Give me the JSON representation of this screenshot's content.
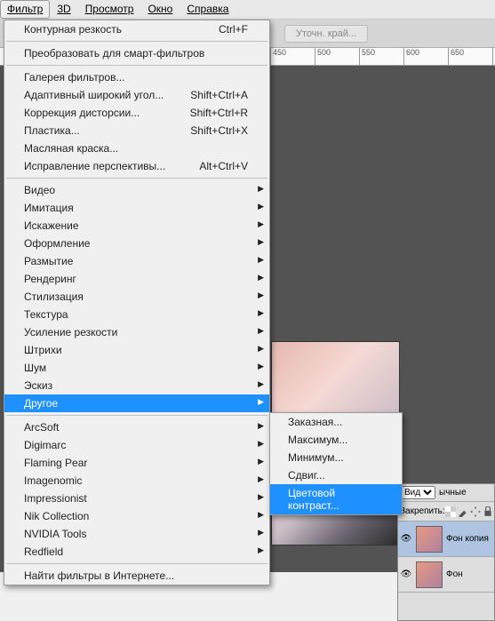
{
  "menubar": {
    "items": [
      "Фильтр",
      "3D",
      "Просмотр",
      "Окно",
      "Справка"
    ]
  },
  "toolbar": {
    "refine": "Уточн. край..."
  },
  "ruler": {
    "ticks": [
      "",
      "450",
      "500",
      "550",
      "600",
      "650"
    ]
  },
  "menu": {
    "s1": [
      {
        "l": "Контурная резкость",
        "s": "Ctrl+F"
      }
    ],
    "s2": [
      {
        "l": "Преобразовать для смарт-фильтров"
      }
    ],
    "s3": [
      {
        "l": "Галерея фильтров..."
      },
      {
        "l": "Адаптивный широкий угол...",
        "s": "Shift+Ctrl+A"
      },
      {
        "l": "Коррекция дисторсии...",
        "s": "Shift+Ctrl+R"
      },
      {
        "l": "Пластика...",
        "s": "Shift+Ctrl+X"
      },
      {
        "l": "Масляная краска..."
      },
      {
        "l": "Исправление перспективы...",
        "s": "Alt+Ctrl+V"
      }
    ],
    "s4": [
      {
        "l": "Видео",
        "a": true
      },
      {
        "l": "Имитация",
        "a": true
      },
      {
        "l": "Искажение",
        "a": true
      },
      {
        "l": "Оформление",
        "a": true
      },
      {
        "l": "Размытие",
        "a": true
      },
      {
        "l": "Рендеринг",
        "a": true
      },
      {
        "l": "Стилизация",
        "a": true
      },
      {
        "l": "Текстура",
        "a": true
      },
      {
        "l": "Усиление резкости",
        "a": true
      },
      {
        "l": "Штрихи",
        "a": true
      },
      {
        "l": "Шум",
        "a": true
      },
      {
        "l": "Эскиз",
        "a": true
      },
      {
        "l": "Другое",
        "a": true,
        "hl": true
      }
    ],
    "s5": [
      {
        "l": "ArcSoft",
        "a": true
      },
      {
        "l": "Digimarc",
        "a": true
      },
      {
        "l": "Flaming Pear",
        "a": true
      },
      {
        "l": "Imagenomic",
        "a": true
      },
      {
        "l": "Impressionist",
        "a": true
      },
      {
        "l": "Nik Collection",
        "a": true
      },
      {
        "l": "NVIDIA Tools",
        "a": true
      },
      {
        "l": "Redfield",
        "a": true
      }
    ],
    "s6": [
      {
        "l": "Найти фильтры в Интернете..."
      }
    ]
  },
  "submenu": {
    "items": [
      {
        "l": "Заказная..."
      },
      {
        "l": "Максимум..."
      },
      {
        "l": "Минимум..."
      },
      {
        "l": "Сдвиг..."
      },
      {
        "l": "Цветовой контраст...",
        "hl": true
      }
    ]
  },
  "layers": {
    "mode": "Вид",
    "tab": "ычные",
    "lock": "Закрепить:",
    "row": [
      {
        "name": "Фон копия",
        "sel": true
      },
      {
        "name": "Фон",
        "sel": false
      }
    ]
  }
}
